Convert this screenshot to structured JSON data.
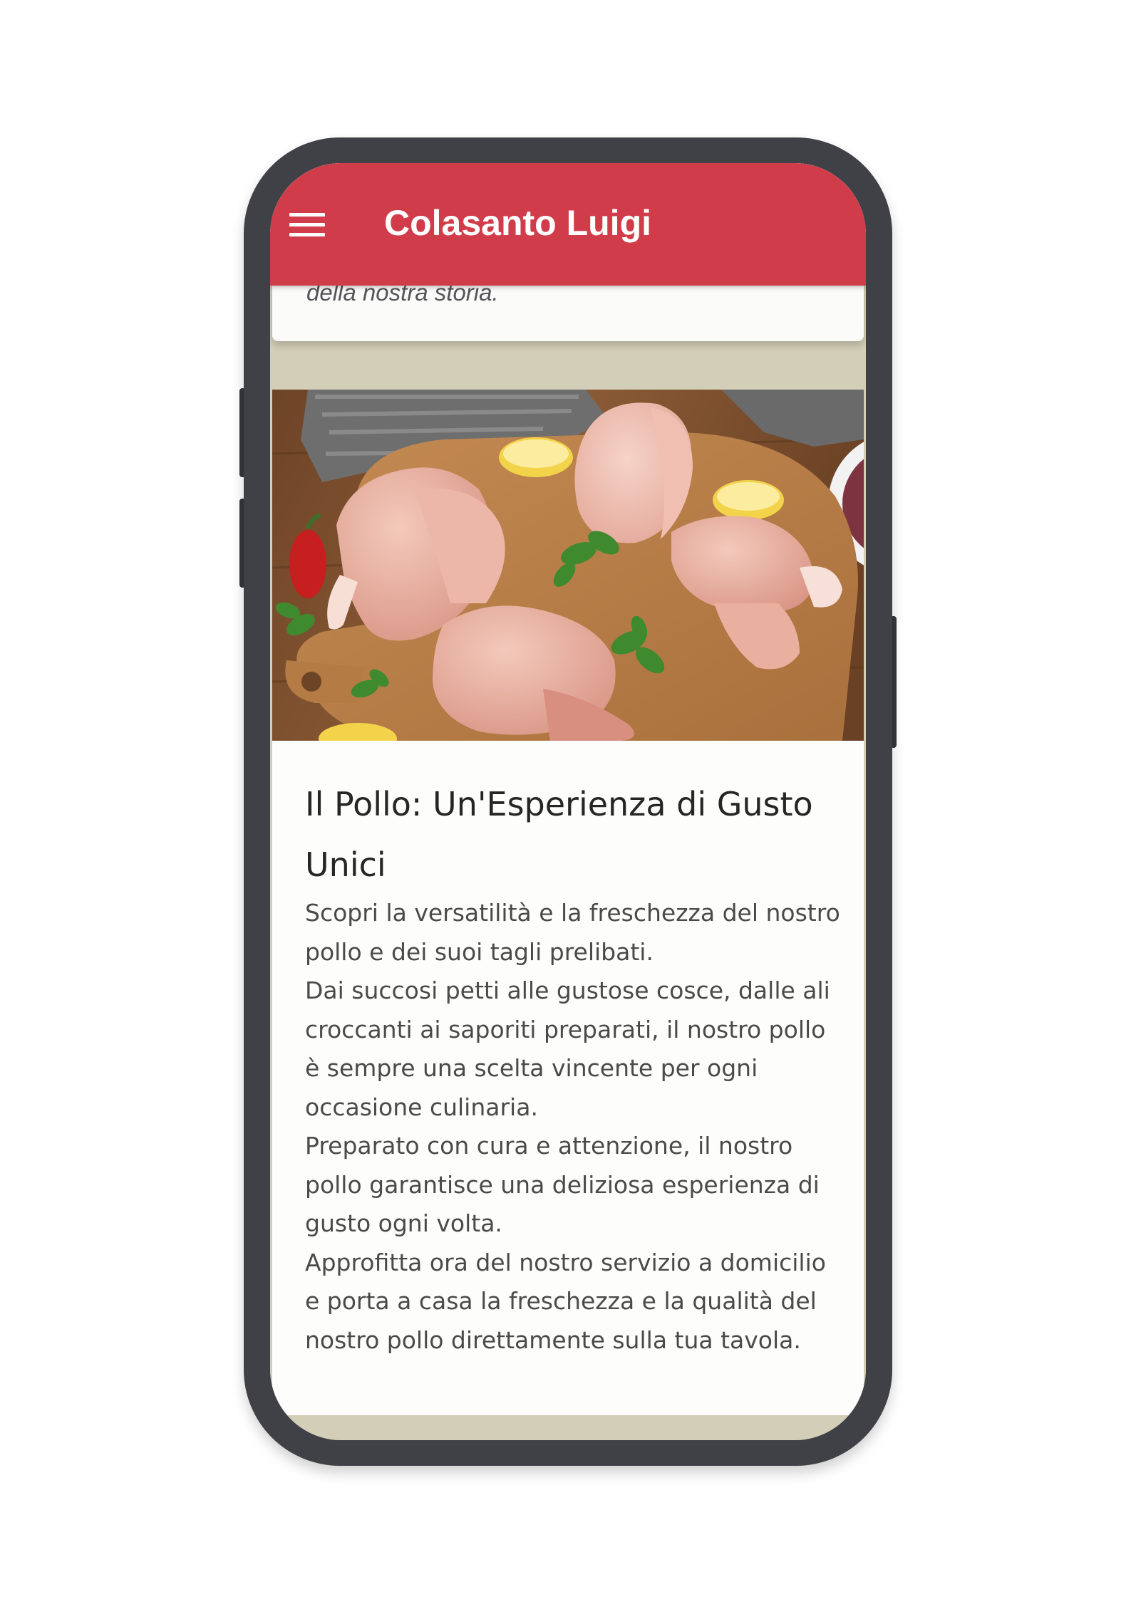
{
  "appbar": {
    "title": "Colasanto Luigi",
    "menu_icon": "hamburger-menu-icon",
    "color": "#d13c4a"
  },
  "previous_card": {
    "text": "della nostra storia."
  },
  "card": {
    "image_description_icon": "raw-chicken-cuts-image",
    "title": "Il Pollo: Un'Esperienza di Gusto Unici",
    "paragraphs": [
      "Scopri la versatilità e la freschezza del nostro pollo e dei suoi tagli prelibati.",
      "Dai succosi petti alle gustose cosce, dalle ali croccanti ai saporiti preparati, il nostro pollo è sempre una scelta vincente per ogni occasione culinaria.",
      "Preparato con cura e attenzione, il nostro pollo garantisce una deliziosa esperienza di gusto ogni volta.",
      "Approfitta ora del nostro servizio a domicilio e porta a casa la freschezza e la qualità del nostro pollo direttamente sulla tua tavola."
    ]
  },
  "colors": {
    "page_background": "#d3ceb7",
    "card_background": "#fdfdfc",
    "phone_frame": "#3f4147"
  }
}
